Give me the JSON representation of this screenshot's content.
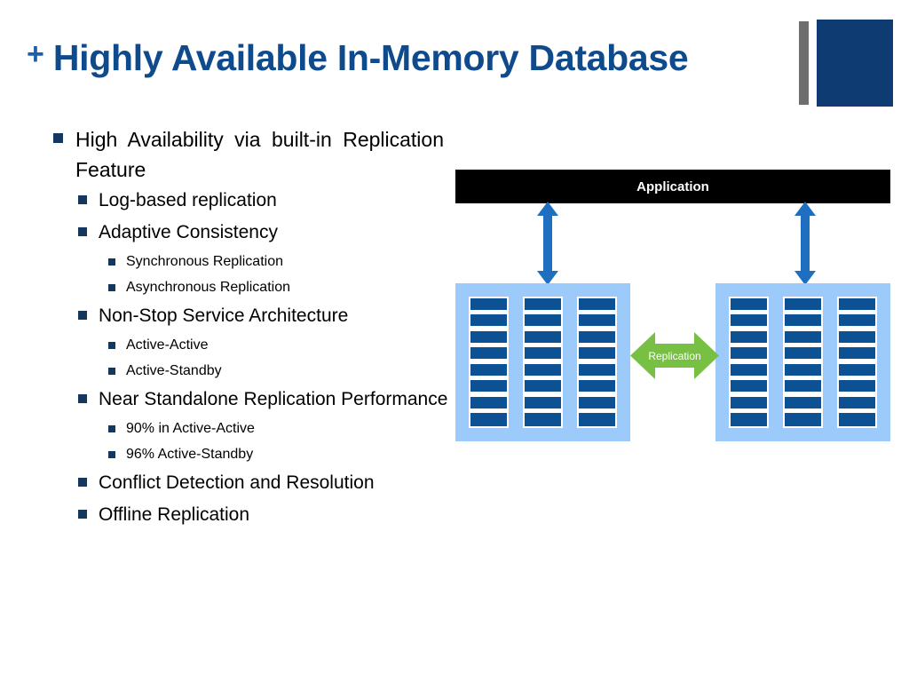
{
  "slide": {
    "title_prefix": "+",
    "title": "Highly Available In-Memory Database"
  },
  "colors": {
    "title_blue": "#0E4A8C",
    "plus_blue": "#1F5FA8",
    "bullet_navy": "#14375F",
    "logo_navy": "#0E3C72",
    "logo_gray": "#6E6E6E",
    "app_bar_black": "#000000",
    "server_group_light_blue": "#9CCAFB",
    "server_unit_blue": "#0B5193",
    "arrow_blue": "#1F6FC0",
    "replication_green": "#77C043"
  },
  "bullets": [
    {
      "level": 1,
      "text": "High Availability via built-in Replication Feature",
      "justify": true
    },
    {
      "level": 2,
      "text": "Log-based replication"
    },
    {
      "level": 2,
      "text": "Adaptive Consistency"
    },
    {
      "level": 3,
      "text": "Synchronous Replication"
    },
    {
      "level": 3,
      "text": "Asynchronous Replication"
    },
    {
      "level": 2,
      "text": "Non-Stop Service Architecture"
    },
    {
      "level": 3,
      "text": "Active-Active"
    },
    {
      "level": 3,
      "text": "Active-Standby"
    },
    {
      "level": 2,
      "text": "Near Standalone Replication Performance",
      "justify": true
    },
    {
      "level": 3,
      "text": "90% in Active-Active"
    },
    {
      "level": 3,
      "text": "96% Active-Standby"
    },
    {
      "level": 2,
      "text": "Conflict Detection and Resolution"
    },
    {
      "level": 2,
      "text": "Offline Replication"
    }
  ],
  "diagram": {
    "application_label": "Application",
    "replication_label": "Replication",
    "racks_per_group": 3,
    "units_per_rack": 8,
    "groups": 2
  }
}
